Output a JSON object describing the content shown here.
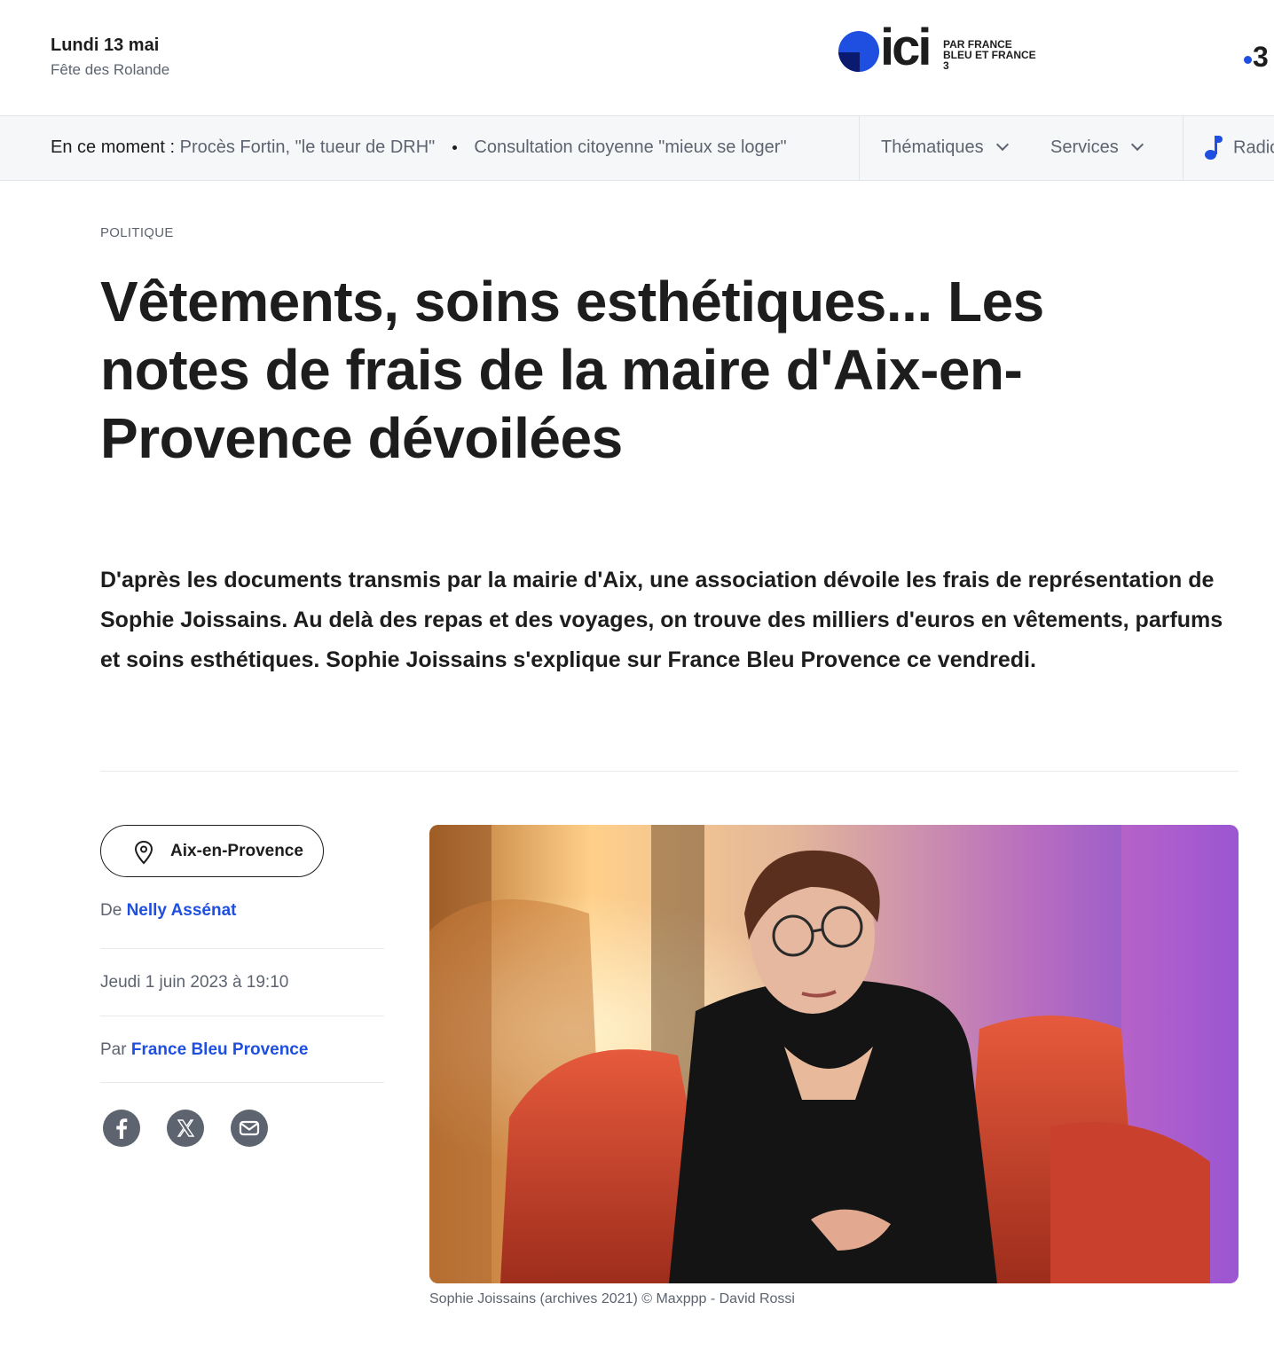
{
  "header": {
    "date": "Lundi 13 mai",
    "saint": "Fête des Rolande",
    "logo_word": "ici",
    "logo_sub": "PAR FRANCE BLEU ET FRANCE 3",
    "f3_label": "3"
  },
  "nav": {
    "now_label": "En ce moment :",
    "now_items": [
      "Procès Fortin, \"le tueur de DRH\"",
      "Consultation citoyenne \"mieux se loger\""
    ],
    "menus": [
      "Thématiques",
      "Services"
    ],
    "radio_label": "Radio"
  },
  "article": {
    "category": "POLITIQUE",
    "title": "Vêtements, soins esthétiques... Les notes de frais de la maire d'Aix-en-Provence dévoilées",
    "lead": "D'après les documents transmis par la mairie d'Aix, une association dévoile les frais de représentation de Sophie Joissains. Au delà des repas et des voyages, on trouve des milliers d'euros en vêtements, parfums et soins esthétiques. Sophie Joissains s'explique sur France Bleu Provence ce vendredi.",
    "location": "Aix-en-Provence",
    "author_prefix": "De",
    "author": "Nelly Assénat",
    "published": "Jeudi 1 juin 2023 à 19:10",
    "source_prefix": "Par",
    "source": "France Bleu Provence",
    "share_icons": [
      "facebook-icon",
      "x-icon",
      "mail-icon"
    ],
    "caption": "Sophie Joissains (archives 2021) © Maxppp - David Rossi"
  },
  "colors": {
    "accent": "#1f4fe0",
    "text": "#1d1d1d",
    "muted": "#5d6470",
    "nav_bg": "#f6f7f9"
  }
}
